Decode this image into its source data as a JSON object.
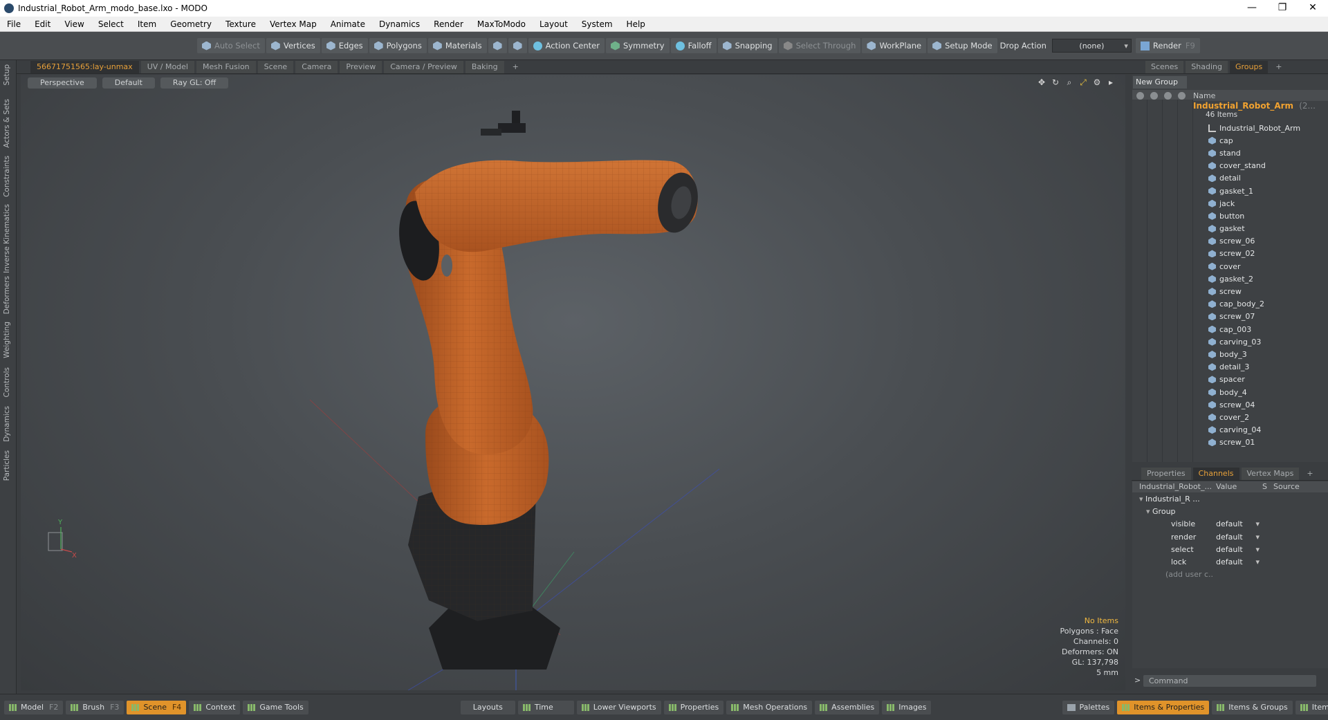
{
  "window": {
    "title": "Industrial_Robot_Arm_modo_base.lxo - MODO",
    "controls": [
      "—",
      "❐",
      "✕"
    ]
  },
  "menu": [
    "File",
    "Edit",
    "View",
    "Select",
    "Item",
    "Geometry",
    "Texture",
    "Vertex Map",
    "Animate",
    "Dynamics",
    "Render",
    "MaxToModo",
    "Layout",
    "System",
    "Help"
  ],
  "toolbar": {
    "auto_select": "Auto Select",
    "vertices": "Vertices",
    "edges": "Edges",
    "polygons": "Polygons",
    "materials": "Materials",
    "action_center": "Action Center",
    "symmetry": "Symmetry",
    "falloff": "Falloff",
    "snapping": "Snapping",
    "select_through": "Select Through",
    "workplane": "WorkPlane",
    "setup_mode": "Setup Mode",
    "drop_action": "Drop Action",
    "drop_value": "(none)",
    "render": "Render",
    "render_key": "F9"
  },
  "left_tabs": [
    "Setup",
    "Actors & Sets",
    "Constraints",
    "Inverse Kinematics",
    "Deformers",
    "Weighting",
    "Controls",
    "Dynamics",
    "Particles"
  ],
  "viewport_tabs": [
    "56671751565:lay-unmax",
    "UV / Model",
    "Mesh Fusion",
    "Scene",
    "Camera",
    "Preview",
    "Camera / Preview",
    "Baking",
    "+"
  ],
  "viewport": {
    "projection": "Perspective",
    "shading": "Default",
    "raygl": "Ray GL: Off",
    "info": {
      "selection": "No Items",
      "polygons": "Polygons : Face",
      "channels": "Channels: 0",
      "deformers": "Deformers: ON",
      "gl": "GL: 137,798",
      "scale": "5 mm"
    },
    "axis": {
      "x": "X",
      "y": "Y"
    }
  },
  "right_tabs": [
    "Scenes",
    "Shading",
    "Groups",
    "+"
  ],
  "groups": {
    "new_group": "New Group",
    "name_col": "Name",
    "root": "Industrial_Robot_Arm",
    "root_suffix": "(2...",
    "root_count": "46 Items",
    "items": [
      "Industrial_Robot_Arm",
      "cap",
      "stand",
      "cover_stand",
      "detail",
      "gasket_1",
      "jack",
      "button",
      "gasket",
      "screw_06",
      "screw_02",
      "cover",
      "gasket_2",
      "screw",
      "cap_body_2",
      "screw_07",
      "cap_003",
      "carving_03",
      "body_3",
      "detail_3",
      "spacer",
      "body_4",
      "screw_04",
      "cover_2",
      "carving_04",
      "screw_01"
    ]
  },
  "props_tabs": [
    "Properties",
    "Channels",
    "Vertex Maps",
    "+"
  ],
  "channels": {
    "col_name": "Industrial_Robot_...",
    "col_value": "Value",
    "col_s": "S",
    "col_source": "Source",
    "tree_root": "Industrial_R ...",
    "group": "Group",
    "rows": [
      {
        "name": "visible",
        "value": "default"
      },
      {
        "name": "render",
        "value": "default"
      },
      {
        "name": "select",
        "value": "default"
      },
      {
        "name": "lock",
        "value": "default"
      }
    ],
    "add_user": "(add user c..."
  },
  "command": {
    "prompt": ">",
    "placeholder": "Command"
  },
  "bottom": {
    "model": "Model",
    "model_key": "F2",
    "brush": "Brush",
    "brush_key": "F3",
    "scene": "Scene",
    "scene_key": "F4",
    "context": "Context",
    "game_tools": "Game Tools",
    "layouts": "Layouts",
    "time": "Time",
    "lower_viewports": "Lower Viewports",
    "properties": "Properties",
    "mesh_operations": "Mesh Operations",
    "assemblies": "Assemblies",
    "images": "Images",
    "palettes": "Palettes",
    "items_properties": "Items & Properties",
    "items_groups": "Items & Groups",
    "items_shading": "Items & Shadin"
  },
  "colors": {
    "accent": "#e8a13a",
    "robot": "#c8672a",
    "active_tab": "#e0932a"
  }
}
